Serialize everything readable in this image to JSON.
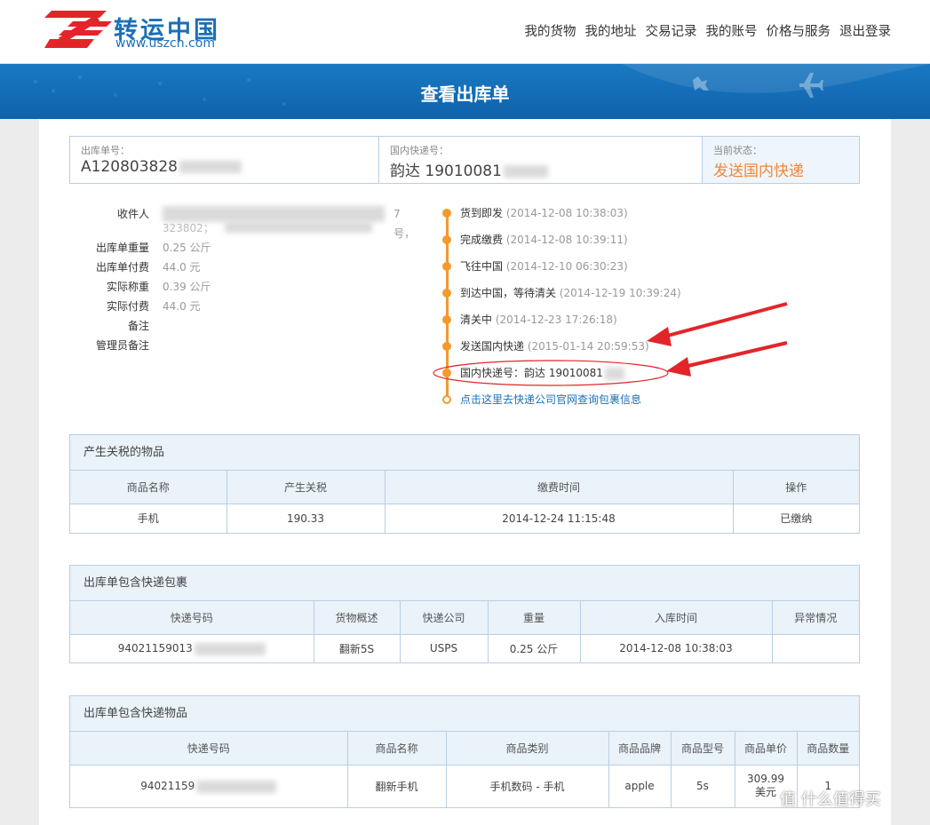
{
  "site": {
    "logo_cn": "转运中国",
    "logo_url": "www.uszcn.com"
  },
  "nav": [
    "我的货物",
    "我的地址",
    "交易记录",
    "我的账号",
    "价格与服务",
    "退出登录"
  ],
  "page_title": "查看出库单",
  "summary": {
    "order_no_label": "出库单号：",
    "order_no": "A120803828",
    "express_label": "国内快递号：",
    "express_no": "韵达 19010081",
    "status_label": "当前状态：",
    "status": "发送国内快递"
  },
  "info": {
    "recipient_label": "收件人",
    "recipient_frag1": "7号，",
    "recipient_frag2": "323802；",
    "rows": [
      {
        "label": "出库单重量",
        "value": "0.25 公斤"
      },
      {
        "label": "出库单付费",
        "value": "44.0 元"
      },
      {
        "label": "实际称重",
        "value": "0.39 公斤"
      },
      {
        "label": "实际付费",
        "value": "44.0 元"
      },
      {
        "label": "备注",
        "value": ""
      },
      {
        "label": "管理员备注",
        "value": ""
      }
    ]
  },
  "timeline": [
    {
      "text": "货到即发",
      "time": "(2014-12-08 10:38:03)"
    },
    {
      "text": "完成缴费",
      "time": "(2014-12-08 10:39:11)"
    },
    {
      "text": "飞往中国",
      "time": "(2014-12-10 06:30:23)"
    },
    {
      "text": "到达中国，等待清关",
      "time": "(2014-12-19 10:39:24)"
    },
    {
      "text": "清关中",
      "time": "(2014-12-23 17:26:18)"
    },
    {
      "text": "发送国内快递",
      "time": "(2015-01-14 20:59:53)"
    },
    {
      "text": "国内快递号：韵达 19010081",
      "time": ""
    }
  ],
  "timeline_link": "点击这里去快递公司官网查询包裹信息",
  "tax_panel": {
    "title": "产生关税的物品",
    "headers": [
      "商品名称",
      "产生关税",
      "缴费时间",
      "操作"
    ],
    "rows": [
      [
        "手机",
        "190.33",
        "2014-12-24 11:15:48",
        "已缴纳"
      ]
    ]
  },
  "parcel_panel": {
    "title": "出库单包含快递包裹",
    "headers": [
      "快递号码",
      "货物概述",
      "快递公司",
      "重量",
      "入库时间",
      "异常情况"
    ],
    "rows": [
      [
        "94021159013",
        "翻新5S",
        "USPS",
        "0.25 公斤",
        "2014-12-08 10:38:03",
        ""
      ]
    ]
  },
  "items_panel": {
    "title": "出库单包含快递物品",
    "headers": [
      "快递号码",
      "商品名称",
      "商品类别",
      "商品品牌",
      "商品型号",
      "商品单价",
      "商品数量"
    ],
    "rows": [
      [
        "94021159",
        "翻新手机",
        "手机数码 - 手机",
        "apple",
        "5s",
        "309.99 美元",
        "1"
      ]
    ]
  },
  "watermark": "值 什么值得买",
  "colors": {
    "brand_blue": "#1a78c2",
    "status_orange": "#f0883a",
    "timeline_orange": "#f39a2c",
    "annotation_red": "#e3252a"
  }
}
